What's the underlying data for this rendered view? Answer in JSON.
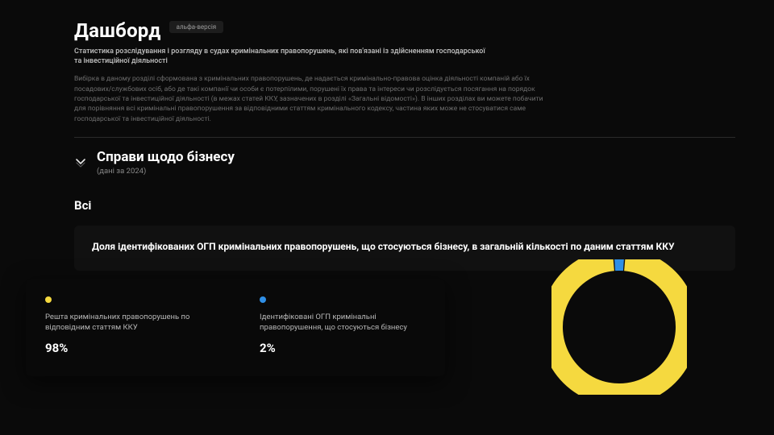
{
  "header": {
    "title": "Дашборд",
    "badge": "альфа-версія",
    "subtitle": "Статистика розслідування і розгляду в судах кримінальних правопорушень,\nякі пов'язані із здійсненням господарської та інвестиційної діяльності",
    "description": "Вибірка в даному розділі сформована з кримінальних правопорушень, де надається кримінально-правова оцінка діяльності компаній або їх посадових/службових осіб, або де такі компанії чи особи є потерпілими, порушені їх права та інтереси чи розслідується посягання на порядок господарської та інвестиційної діяльності (в межах статей ККУ, зазначених в розділі «Загальні відомості»). В інших розділах ви можете побачити для порівняння всі кримінальні правопорушення за відповідними статтям кримінального кодексу, частина яких може не стосуватися саме господарської та інвестиційної діяльності."
  },
  "section": {
    "title": "Справи щодо бізнесу",
    "subtitle": "(дані за 2024)"
  },
  "filter": {
    "selected": "Всі"
  },
  "card": {
    "title": "Доля ідентифікованих ОГП кримінальних правопорушень, що стосуються бізнесу, в загальній кількості по даним статтям ККУ"
  },
  "legend": {
    "items": [
      {
        "color": "yellow",
        "label": "Решта кримінальних правопорушень по відповідним статтям ККУ",
        "value": "98%"
      },
      {
        "color": "blue",
        "label": "Ідентифіковані ОГП кримінальні правопорушення, що стосуються бізнесу",
        "value": "2%"
      }
    ]
  },
  "chart_data": {
    "type": "pie",
    "title": "Доля ідентифікованих ОГП кримінальних правопорушень, що стосуються бізнесу, в загальній кількості по даним статтям ККУ",
    "series": [
      {
        "name": "Решта кримінальних правопорушень по відповідним статтям ККУ",
        "value": 98,
        "color": "#f5d93f"
      },
      {
        "name": "Ідентифіковані ОГП кримінальні правопорушення, що стосуються бізнесу",
        "value": 2,
        "color": "#2f8fe6"
      }
    ],
    "unit": "%",
    "donut": true
  }
}
